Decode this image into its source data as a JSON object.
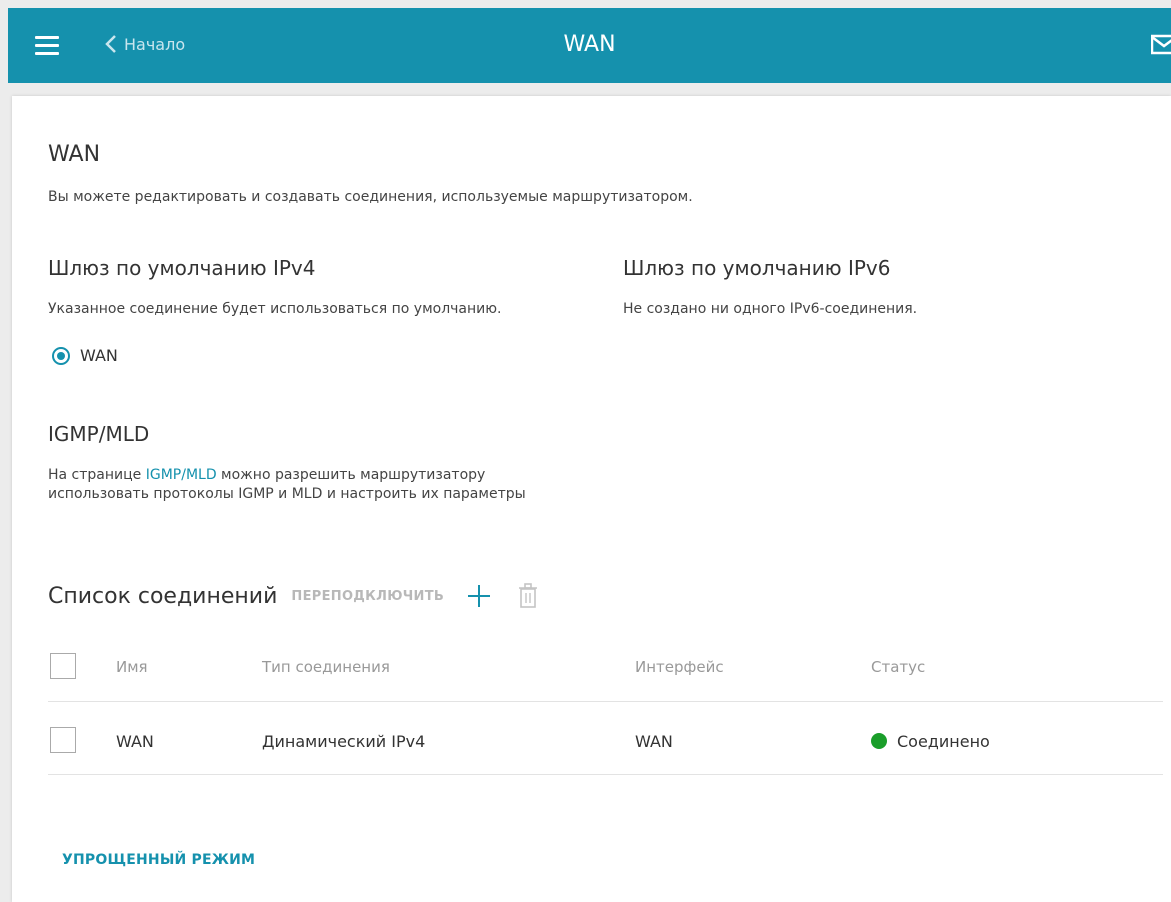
{
  "header": {
    "menu_icon": "hamburger-icon",
    "back_label": "Начало",
    "title": "WAN",
    "mail_icon": "mail-icon"
  },
  "page": {
    "title": "WAN",
    "description": "Вы можете редактировать и создавать соединения, используемые маршрутизатором."
  },
  "gateway_ipv4": {
    "title": "Шлюз по умолчанию IPv4",
    "description": "Указанное соединение будет использоваться по умолчанию.",
    "radio_label": "WAN"
  },
  "gateway_ipv6": {
    "title": "Шлюз по умолчанию IPv6",
    "description": "Не создано ни одного IPv6-соединения."
  },
  "igmp": {
    "title": "IGMP/MLD",
    "text_before": "На странице ",
    "link": "IGMP/MLD",
    "text_after": " можно разрешить маршрутизатору использовать протоколы IGMP и MLD и настроить их параметры"
  },
  "connections": {
    "title": "Список соединений",
    "reconnect_label": "ПЕРЕПОДКЛЮЧИТЬ",
    "add_icon": "plus-icon",
    "delete_icon": "trash-icon",
    "columns": [
      "Имя",
      "Тип соединения",
      "Интерфейс",
      "Статус"
    ],
    "rows": [
      {
        "name": "WAN",
        "type": "Динамический IPv4",
        "interface": "WAN",
        "status": "Соединено",
        "status_color": "#1a9e2a"
      }
    ]
  },
  "simple_mode_label": "УПРОЩЕННЫЙ РЕЖИМ",
  "colors": {
    "accent": "#1591ad",
    "status_ok": "#1a9e2a"
  }
}
